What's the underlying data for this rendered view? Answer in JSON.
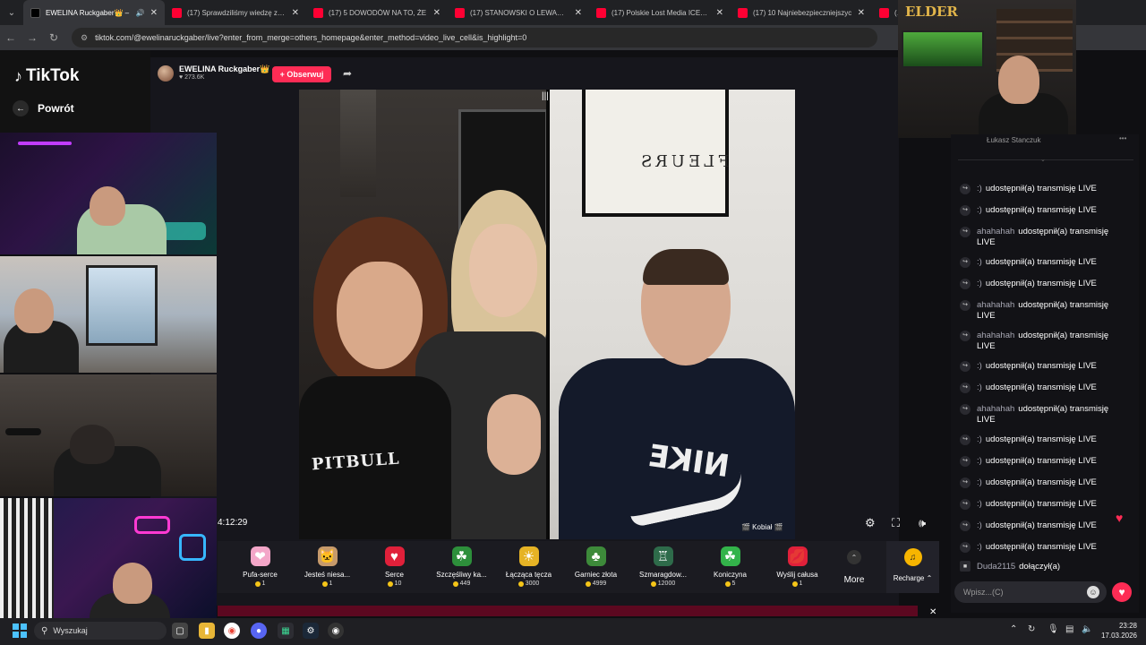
{
  "browser": {
    "tabs": [
      {
        "title": "EWELINA Ruckgaber👑 –",
        "favicon": "tiktok-icon",
        "active": true,
        "audio": true
      },
      {
        "title": "(17) Sprawdziliśmy wiedzę z ma",
        "favicon": "youtube-icon",
        "active": false
      },
      {
        "title": "(17) 5 DOWODÓW NA TO, ŻE",
        "favicon": "youtube-icon",
        "active": false
      },
      {
        "title": "(17) STANOWSKI O LEWANDO",
        "favicon": "youtube-icon",
        "active": false
      },
      {
        "title": "(17) Polskie Lost Media ICEBER",
        "favicon": "youtube-icon",
        "active": false
      },
      {
        "title": "(17) 10 Najniebezpieczniejszyc",
        "favicon": "youtube-icon",
        "active": false
      },
      {
        "title": "(1",
        "favicon": "youtube-icon",
        "active": false
      }
    ],
    "url": "tiktok.com/@ewelinaruckgaber/live?enter_from_merge=others_homepage&enter_method=video_live_cell&is_highlight=0"
  },
  "sidebar": {
    "logo_text": "TikTok",
    "back_label": "Powrót"
  },
  "live": {
    "host_name": "EWELINA Ruckgaber👑 –",
    "likes": "♥ 273.6K",
    "follow_label": "+ Obserwuj",
    "timer": "4:12:29",
    "video_tag": "🎬 Kobiał 🎬",
    "shirt_text": "PITBULL",
    "poster_text": "FLEURS",
    "hoodie_text": "NIKE"
  },
  "gifts": [
    {
      "name": "Pufa-serce",
      "price": "1",
      "icon": "cotton-candy-heart-icon",
      "color": "#f3a6c8",
      "glyph": "❤"
    },
    {
      "name": "Jesteś niesa...",
      "price": "1",
      "icon": "cat-icon",
      "color": "#c79a6b",
      "glyph": "🐱"
    },
    {
      "name": "Serce",
      "price": "10",
      "icon": "heart-icon",
      "color": "#e0203a",
      "glyph": "♥"
    },
    {
      "name": "Szczęśliwy ka...",
      "price": "449",
      "icon": "lucky-hat-icon",
      "color": "#2d8f3b",
      "glyph": "☘"
    },
    {
      "name": "Łącząca tęcza",
      "price": "3000",
      "icon": "rainbow-icon",
      "color": "#e6b325",
      "glyph": "☀"
    },
    {
      "name": "Garniec złota",
      "price": "4999",
      "icon": "leprechaun-icon",
      "color": "#3d8a3a",
      "glyph": "♣"
    },
    {
      "name": "Szmaragdow...",
      "price": "12000",
      "icon": "emerald-castle-icon",
      "color": "#2e6b4a",
      "glyph": "♖"
    },
    {
      "name": "Koniczyna",
      "price": "5",
      "icon": "clover-icon",
      "color": "#33b34a",
      "glyph": "☘"
    },
    {
      "name": "Wyślij całusa",
      "price": "1",
      "icon": "kiss-lips-icon",
      "color": "#e0203a",
      "glyph": "💋"
    }
  ],
  "more_label": "More",
  "recharge_label": "Recharge ⌃",
  "chat": {
    "top_name": "Łukasz Stanczuk",
    "messages": [
      {
        "user": ":)",
        "text": "udostępnił(a) transmisję LIVE"
      },
      {
        "user": ":)",
        "text": "udostępnił(a) transmisję LIVE"
      },
      {
        "user": "ahahahah",
        "text": "udostępnił(a) transmisję LIVE"
      },
      {
        "user": ":)",
        "text": "udostępnił(a) transmisję LIVE"
      },
      {
        "user": ":)",
        "text": "udostępnił(a) transmisję LIVE"
      },
      {
        "user": "ahahahah",
        "text": "udostępnił(a) transmisję LIVE"
      },
      {
        "user": "ahahahah",
        "text": "udostępnił(a) transmisję LIVE"
      },
      {
        "user": ":)",
        "text": "udostępnił(a) transmisję LIVE"
      },
      {
        "user": ":)",
        "text": "udostępnił(a) transmisję LIVE"
      },
      {
        "user": "ahahahah",
        "text": "udostępnił(a) transmisję LIVE"
      },
      {
        "user": ":)",
        "text": "udostępnił(a) transmisję LIVE"
      },
      {
        "user": ":)",
        "text": "udostępnił(a) transmisję LIVE"
      },
      {
        "user": ":)",
        "text": "udostępnił(a) transmisję LIVE"
      },
      {
        "user": ":)",
        "text": "udostępnił(a) transmisję LIVE"
      },
      {
        "user": ":)",
        "text": "udostępnił(a) transmisję LIVE"
      },
      {
        "user": ":)",
        "text": "udostępnił(a) transmisję LIVE"
      }
    ],
    "join_user": "Duda2115",
    "join_text": "dołączył(a)",
    "input_placeholder": "Wpisz...(C)"
  },
  "overlay": {
    "streamer_logo": "ELDER"
  },
  "taskbar": {
    "search_placeholder": "Wyszukaj",
    "time": "23:28",
    "date": "17.03.2026"
  },
  "colors": {
    "accent": "#fe2c55",
    "coin": "#f5c518"
  }
}
